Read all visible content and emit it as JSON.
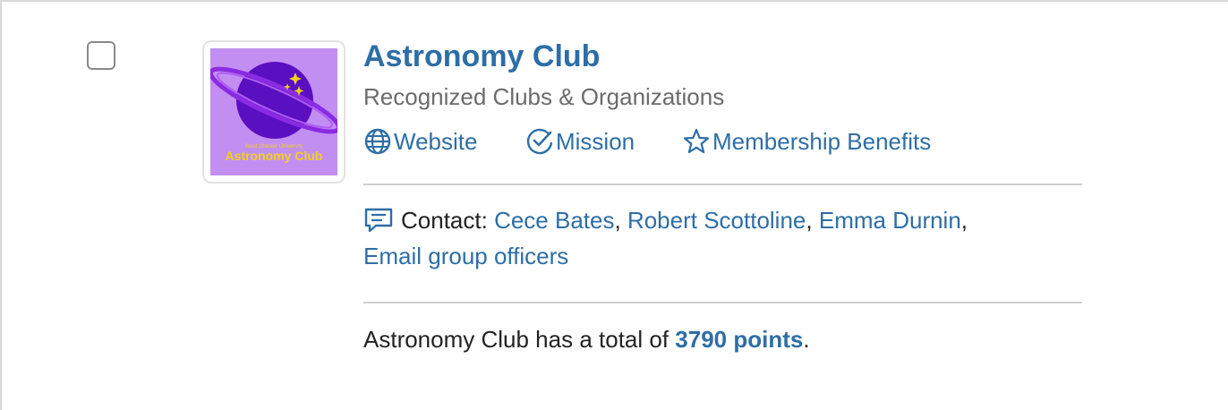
{
  "org": {
    "name": "Astronomy Club",
    "category": "Recognized Clubs & Organizations",
    "logo": {
      "caption": "Astronomy Club",
      "subcaption": "West Chester University",
      "bg_color": "#c38ef2",
      "planet_color": "#5a0fc0",
      "text_color": "#f2d21b"
    }
  },
  "links": {
    "website_label": "Website",
    "mission_label": "Mission",
    "benefits_label": "Membership Benefits",
    "website_icon": "globe-icon",
    "mission_icon": "check-circle-icon",
    "benefits_icon": "star-icon"
  },
  "contact": {
    "label": "Contact:",
    "icon": "comment-icon",
    "people": [
      "Cece Bates",
      "Robert Scottoline",
      "Emma Durnin"
    ],
    "separator": ",",
    "email_officers": "Email group officers"
  },
  "points": {
    "prefix": "Astronomy Club has a total of",
    "value": "3790 points",
    "suffix": "."
  },
  "colors": {
    "link": "#2e6ea6",
    "muted": "#6b6b6b",
    "divider": "#cfcfcf"
  }
}
